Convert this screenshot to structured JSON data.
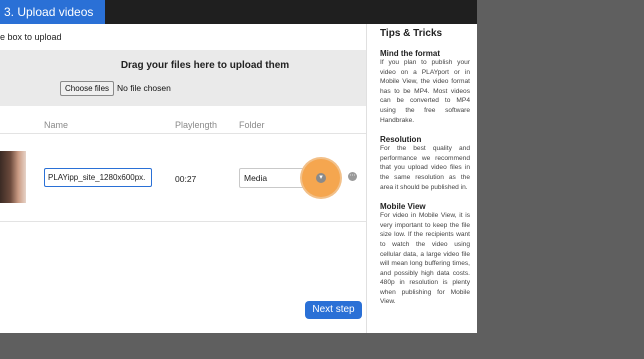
{
  "header": {
    "step_title": "3. Upload videos"
  },
  "upload": {
    "instruction": "e box to upload",
    "drop_title": "Drag your files here to upload them",
    "choose_button": "Choose files",
    "no_file_text": "No file chosen"
  },
  "table": {
    "columns": [
      "Name",
      "Playlength",
      "Folder"
    ],
    "rows": [
      {
        "name": "PLAYipp_site_1280x600px.",
        "playlength": "00:27",
        "folder": "Media"
      }
    ]
  },
  "footer": {
    "next_button": "Next step"
  },
  "tips": {
    "title": "Tips & Tricks",
    "sections": [
      {
        "heading": "Mind the format",
        "body": "If you plan to publish your video on a PLAYport or in Mobile View, the video format has to be MP4. Most videos can be converted to MP4 using the free software Handbrake."
      },
      {
        "heading": "Resolution",
        "body": "For the best quality and performance we recommend that you upload video files in the same resolution as the area it should be published in."
      },
      {
        "heading": "Mobile View",
        "body": "For video in Mobile View, it is very important to keep the file size low. If the recipients want to watch the video using cellular data, a large video file will mean long buffering times, and possibly high data costs. 480p in resolution is plenty when publishing for Mobile View."
      }
    ]
  },
  "icons": {
    "folder_dropdown": "chevron-down-icon",
    "row_menu": "more-options-icon"
  },
  "colors": {
    "accent": "#2a70d6",
    "highlight": "#f5a64f",
    "backdrop": "#5f5f5f"
  }
}
